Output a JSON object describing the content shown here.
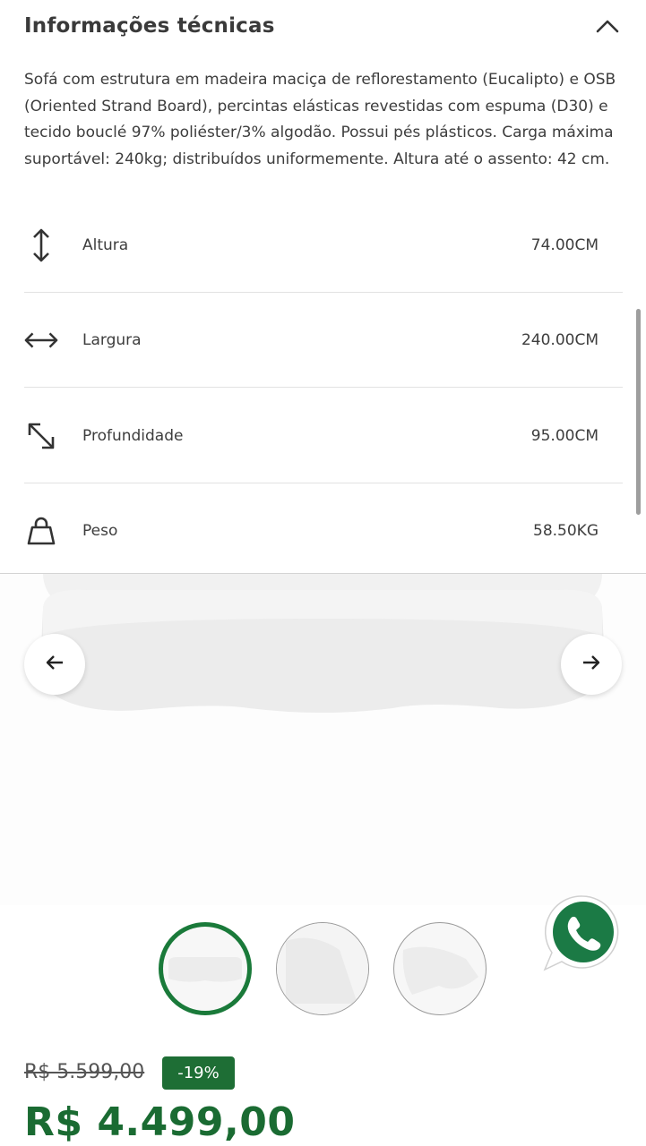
{
  "tech_info": {
    "title": "Informações técnicas",
    "description": "Sofá com estrutura em madeira maciça de reflorestamento (Eucalipto) e OSB (Oriented Strand Board), percintas elásticas revestidas com espuma (D30) e tecido bouclé 97% poliéster/3% algodão. Possui pés plásticos. Carga máxima suportável: 240kg; distribuídos uniformemente. Altura até o assento: 42 cm.",
    "specs": [
      {
        "icon": "vertical-arrows-icon",
        "label": "Altura",
        "value": "74.00CM"
      },
      {
        "icon": "horizontal-arrows-icon",
        "label": "Largura",
        "value": "240.00CM"
      },
      {
        "icon": "diagonal-arrows-icon",
        "label": "Profundidade",
        "value": "95.00CM"
      },
      {
        "icon": "weight-icon",
        "label": "Peso",
        "value": "58.50KG"
      }
    ]
  },
  "gallery": {
    "prev_icon": "arrow-left-icon",
    "next_icon": "arrow-right-icon",
    "thumbnail_count": 3,
    "active_thumbnail": 1
  },
  "pricing": {
    "old_price": "R$ 5.599,00",
    "discount": "-19%",
    "price": "R$ 4.499,00"
  },
  "colors": {
    "brand_green": "#1a6b32",
    "badge_green": "#1e6e35",
    "whatsapp_green": "#1b7a45"
  }
}
